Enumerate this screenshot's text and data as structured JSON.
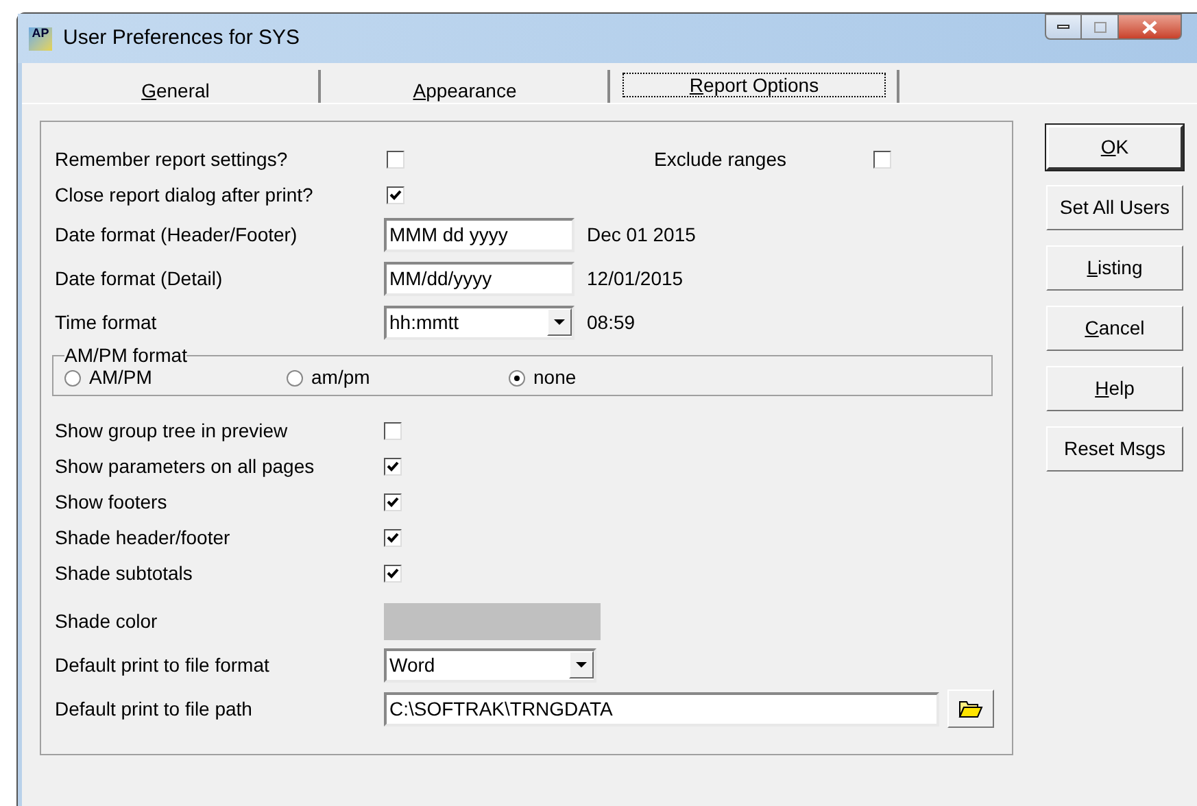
{
  "window": {
    "title": "User Preferences for SYS",
    "app_icon_text": "AP"
  },
  "tabs": [
    {
      "mnemonic": "G",
      "label_rest": "eneral",
      "selected": false
    },
    {
      "mnemonic": "A",
      "label_rest": "ppearance",
      "selected": false
    },
    {
      "mnemonic": "R",
      "label_rest": "eport Options",
      "selected": true
    }
  ],
  "top_checks": [
    {
      "label": "Remember report settings?",
      "checked": false
    },
    {
      "label": "Close report dialog after print?",
      "checked": true
    }
  ],
  "exclude_ranges": {
    "label": "Exclude ranges",
    "checked": false
  },
  "format_fields": [
    {
      "kind": "text",
      "label": "Date format (Header/Footer)",
      "value": "MMM dd yyyy",
      "preview": "Dec 01 2015"
    },
    {
      "kind": "text",
      "label": "Date format (Detail)",
      "value": "MM/dd/yyyy",
      "preview": "12/01/2015"
    },
    {
      "kind": "dropdown",
      "label": "Time format",
      "value": "hh:mmtt",
      "preview": "08:59"
    }
  ],
  "ampm_group": {
    "title": "AM/PM format",
    "options": [
      {
        "label": "AM/PM",
        "selected": false
      },
      {
        "label": "am/pm",
        "selected": false
      },
      {
        "label": "none",
        "selected": true
      }
    ]
  },
  "checks": [
    {
      "label": "Show group tree in preview",
      "checked": false
    },
    {
      "label": "Show parameters on all pages",
      "checked": true
    },
    {
      "label": "Show footers",
      "checked": true
    },
    {
      "label": "Shade header/footer",
      "checked": true
    },
    {
      "label": "Shade subtotals",
      "checked": true
    }
  ],
  "shade_color": {
    "label": "Shade color",
    "color": "#c0c0c0"
  },
  "print_format": {
    "label": "Default print to file format",
    "value": "Word"
  },
  "print_path": {
    "label": "Default print to file path",
    "value": "C:\\SOFTRAK\\TRNGDATA"
  },
  "buttons": [
    {
      "mnemonic": "O",
      "label_rest": "K",
      "default": true
    },
    {
      "label": "Set All Users",
      "default": false
    },
    {
      "mnemonic": "L",
      "label_rest": "isting",
      "default": false
    },
    {
      "mnemonic": "C",
      "label_rest": "ancel",
      "default": false
    },
    {
      "mnemonic": "H",
      "label_rest": "elp",
      "default": false
    },
    {
      "label": "Reset Msgs",
      "default": false
    }
  ]
}
